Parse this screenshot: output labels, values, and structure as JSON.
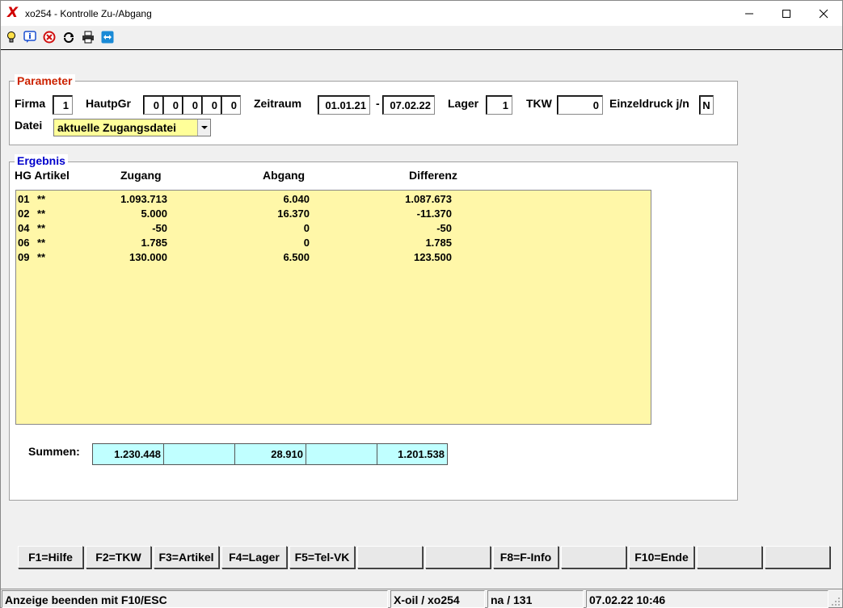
{
  "window": {
    "title": "xo254 - Kontrolle Zu-/Abgang",
    "logo": "X",
    "controls": [
      "minimize-icon",
      "maximize-icon",
      "close-icon"
    ]
  },
  "toolbar": {
    "icons": [
      "lightbulb-icon",
      "info-icon",
      "stop-icon",
      "refresh-icon",
      "printer-icon",
      "remote-icon"
    ]
  },
  "parameter": {
    "legend": "Parameter",
    "legend_color": "#cc2200",
    "firma_label": "Firma",
    "firma_value": "1",
    "hauptgr_label": "HautpGr",
    "hauptgr_values": [
      "0",
      "0",
      "0",
      "0",
      "0"
    ],
    "zeitraum_label": "Zeitraum",
    "zeitraum_from": "01.01.21",
    "zeitraum_sep": "-",
    "zeitraum_to": "07.02.22",
    "lager_label": "Lager",
    "lager_value": "1",
    "tkw_label": "TKW",
    "tkw_value": "0",
    "einzeldruck_label": "Einzeldruck j/n",
    "einzeldruck_value": "N",
    "datei_label": "Datei",
    "datei_value": "aktuelle Zugangsdatei"
  },
  "ergebnis": {
    "legend": "Ergebnis",
    "legend_color": "#0000cc",
    "headers": {
      "hg_artikel": "HG Artikel",
      "zugang": "Zugang",
      "abgang": "Abgang",
      "differenz": "Differenz"
    },
    "rows": [
      {
        "hg": "01",
        "artikel": "**",
        "zugang": "1.093.713",
        "abgang": "6.040",
        "differenz": "1.087.673"
      },
      {
        "hg": "02",
        "artikel": "**",
        "zugang": "5.000",
        "abgang": "16.370",
        "differenz": "-11.370"
      },
      {
        "hg": "04",
        "artikel": "**",
        "zugang": "-50",
        "abgang": "0",
        "differenz": "-50"
      },
      {
        "hg": "06",
        "artikel": "**",
        "zugang": "1.785",
        "abgang": "0",
        "differenz": "1.785"
      },
      {
        "hg": "09",
        "artikel": "**",
        "zugang": "130.000",
        "abgang": "6.500",
        "differenz": "123.500"
      }
    ],
    "summen_label": "Summen:",
    "summen": {
      "zugang": "1.230.448",
      "blank1": "",
      "abgang": "28.910",
      "blank2": "",
      "differenz": "1.201.538"
    }
  },
  "function_keys": [
    {
      "label": "F1=Hilfe"
    },
    {
      "label": "F2=TKW"
    },
    {
      "label": "F3=Artikel"
    },
    {
      "label": "F4=Lager"
    },
    {
      "label": "F5=Tel-VK"
    },
    {
      "label": ""
    },
    {
      "label": ""
    },
    {
      "label": "F8=F-Info"
    },
    {
      "label": ""
    },
    {
      "label": "F10=Ende"
    },
    {
      "label": ""
    },
    {
      "label": ""
    }
  ],
  "statusbar": {
    "message": "Anzeige beenden mit F10/ESC",
    "program": "X-oil / xo254",
    "user": "na / 131",
    "datetime": "07.02.22 10:46"
  }
}
